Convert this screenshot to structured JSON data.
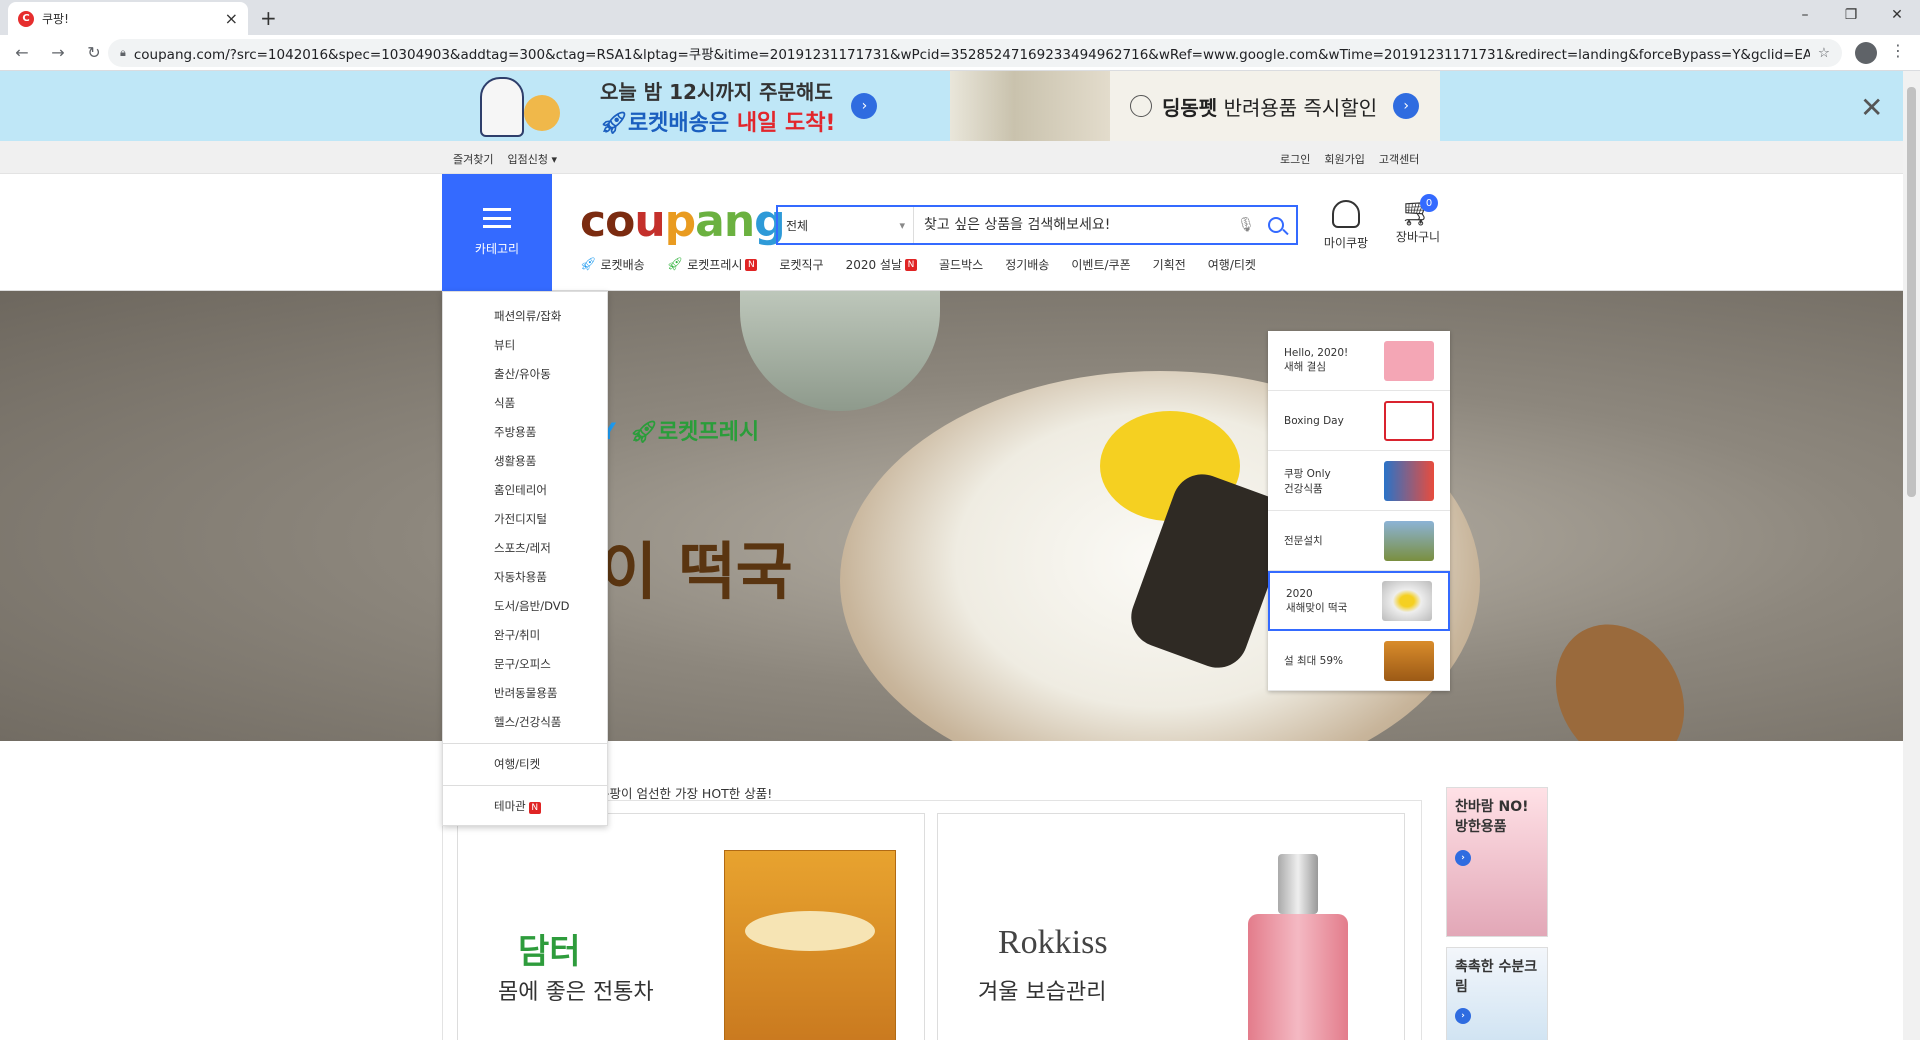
{
  "browser": {
    "tab_title": "쿠팡!",
    "tab_favicon_letter": "C",
    "address": "coupang.com/?src=1042016&spec=10304903&addtag=300&ctag=RSA1&lptag=쿠팡&itime=20191231171731&wPcid=35285247169233494962716&wRef=www.google.com&wTime=20191231171731&redirect=landing&forceBypass=Y&gclid=EAIaIQobChMIvc..."
  },
  "promo": {
    "left_line1": "오늘 밤 12시까지 주문해도",
    "left_line2_a": "로켓배송은",
    "left_line2_b": "내일 도착!",
    "right_brand": "딩동펫",
    "right_text": "반려용품 즉시할인"
  },
  "util": {
    "left": [
      "즐겨찾기",
      "입점신청 ▾"
    ],
    "right": [
      "로그인",
      "회원가입",
      "고객센터"
    ]
  },
  "header": {
    "category_label": "카테고리",
    "logo_parts": [
      "co",
      "u",
      "p",
      "an",
      "g"
    ],
    "search_scope": "전체",
    "search_placeholder": "찾고 싶은 상품을 검색해보세요!",
    "my_coupang": "마이쿠팡",
    "cart_label": "장바구니",
    "cart_count": "0",
    "gnb": [
      "로켓배송",
      "로켓프레시",
      "로켓직구",
      "2020 설날",
      "골드박스",
      "정기배송",
      "이벤트/쿠폰",
      "기획전",
      "여행/티켓"
    ]
  },
  "hero": {
    "text1": "Y",
    "text1_rocket": "로켓프레시",
    "text2": "이 떡국",
    "menu": [
      {
        "label_1": "Hello, 2020!",
        "label_2": "새해 결심"
      },
      {
        "label_1": "Boxing Day",
        "label_2": ""
      },
      {
        "label_1": "쿠팡 Only",
        "label_2": "건강식품"
      },
      {
        "label_1": "전문설치",
        "label_2": ""
      },
      {
        "label_1": "2020",
        "label_2": "새해맞이 떡국"
      },
      {
        "label_1": "설 최대 59%",
        "label_2": ""
      }
    ]
  },
  "category_menu": {
    "items": [
      "패션의류/잡화",
      "뷰티",
      "출산/유아동",
      "식품",
      "주방용품",
      "생활용품",
      "홈인테리어",
      "가전디지털",
      "스포츠/레저",
      "자동차용품",
      "도서/음반/DVD",
      "완구/취미",
      "문구/오피스",
      "반려동물용품",
      "헬스/건강식품"
    ],
    "travel": "여행/티켓",
    "theme": "테마관"
  },
  "content": {
    "subtitle": "쿠팡이 엄선한 가장 HOT한 상품!",
    "card1_brand": "담터",
    "card1_slogan": "몸에 좋은 전통차",
    "card2_brand": "Rokkiss",
    "card2_slogan": "겨울 보습관리",
    "side1": "찬바람 NO! 방한용품",
    "side2": "촉촉한 수분크림"
  }
}
